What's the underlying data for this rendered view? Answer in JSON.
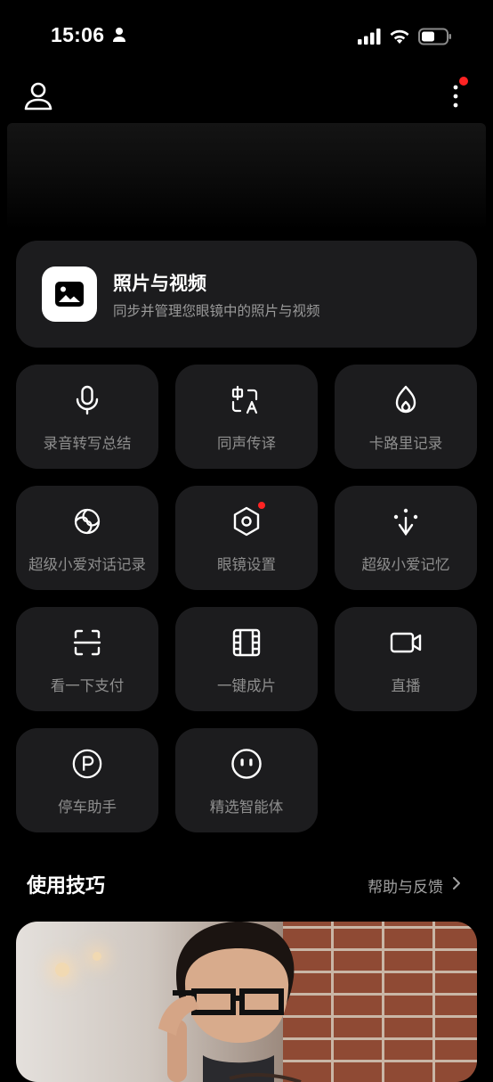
{
  "status_bar": {
    "time": "15:06"
  },
  "photos_card": {
    "title": "照片与视频",
    "subtitle": "同步并管理您眼镜中的照片与视频"
  },
  "tiles": [
    {
      "label": "录音转写总结",
      "icon": "microphone-icon"
    },
    {
      "label": "同声传译",
      "icon": "translate-icon"
    },
    {
      "label": "卡路里记录",
      "icon": "flame-icon"
    },
    {
      "label": "超级小爱对话记录",
      "icon": "ai-swirl-icon"
    },
    {
      "label": "眼镜设置",
      "icon": "hexagon-settings-icon"
    },
    {
      "label": "超级小爱记忆",
      "icon": "memory-icon"
    },
    {
      "label": "看一下支付",
      "icon": "scan-icon"
    },
    {
      "label": "一键成片",
      "icon": "film-icon"
    },
    {
      "label": "直播",
      "icon": "video-camera-icon"
    },
    {
      "label": "停车助手",
      "icon": "parking-icon"
    },
    {
      "label": "精选智能体",
      "icon": "agent-face-icon"
    }
  ],
  "tips": {
    "title": "使用技巧",
    "link": "帮助与反馈"
  },
  "colors": {
    "background": "#000000",
    "card": "#1c1c1e",
    "notification_dot": "#ff2323"
  }
}
